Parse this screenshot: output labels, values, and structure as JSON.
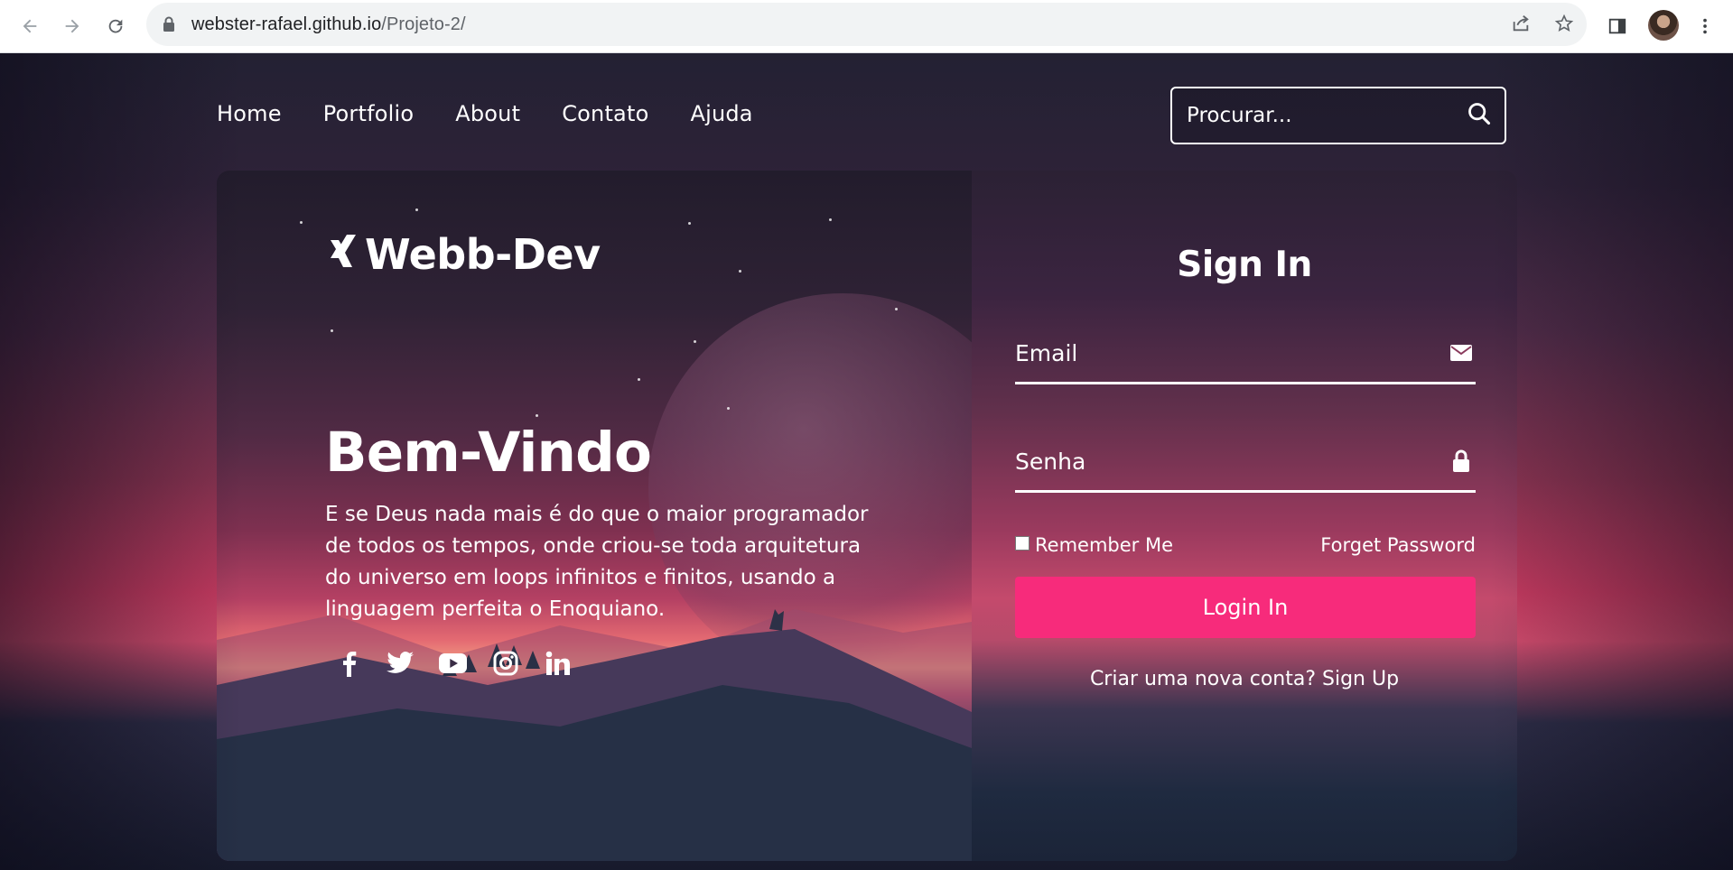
{
  "browser": {
    "url_domain": "webster-rafael.github.io",
    "url_path": "/Projeto-2/"
  },
  "nav": {
    "items": [
      "Home",
      "Portfolio",
      "About",
      "Contato",
      "Ajuda"
    ]
  },
  "search": {
    "placeholder": "Procurar..."
  },
  "hero": {
    "logo_text": "Webb-Dev",
    "heading": "Bem-Vindo",
    "description": "E se Deus nada mais é do que o maior programador de todos os tempos, onde criou-se toda arquitetura do universo em loops infinitos e finitos, usando a linguagem perfeita o Enoquiano.",
    "socials": [
      "facebook-icon",
      "twitter-icon",
      "youtube-icon",
      "instagram-icon",
      "linkedin-icon"
    ]
  },
  "form": {
    "title": "Sign In",
    "email_label": "Email",
    "password_label": "Senha",
    "remember_label": "Remember Me",
    "forget_label": "Forget Password",
    "login_button": "Login In",
    "signup_text": "Criar uma nova conta? Sign Up"
  },
  "colors": {
    "accent": "#f72b7b",
    "text": "#ffffff"
  }
}
